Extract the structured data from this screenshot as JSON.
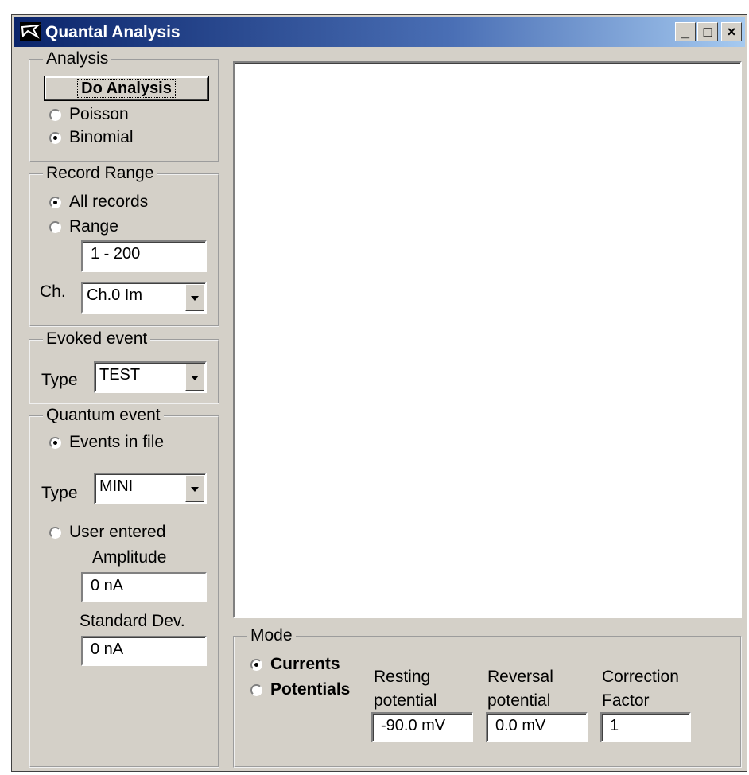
{
  "window": {
    "title": "Quantal Analysis",
    "controls": {
      "minimize": "_",
      "maximize": "□",
      "close": "×"
    }
  },
  "analysis": {
    "legend": "Analysis",
    "do_analysis_label": "Do Analysis",
    "options": [
      {
        "label": "Poisson",
        "selected": false
      },
      {
        "label": "Binomial",
        "selected": true
      }
    ]
  },
  "record_range": {
    "legend": "Record Range",
    "all_records_label": "All records",
    "all_records_selected": true,
    "range_label": "Range",
    "range_selected": false,
    "range_value": "1 - 200",
    "channel_label": "Ch.",
    "channel_value": "Ch.0 Im"
  },
  "evoked_event": {
    "legend": "Evoked event",
    "type_label": "Type",
    "type_value": "TEST"
  },
  "quantum_event": {
    "legend": "Quantum event",
    "events_in_file_label": "Events in file",
    "events_in_file_selected": true,
    "type_label": "Type",
    "type_value": "MINI",
    "user_entered_label": "User entered",
    "user_entered_selected": false,
    "amplitude_label": "Amplitude",
    "amplitude_value": "0 nA",
    "std_dev_label": "Standard Dev.",
    "std_dev_value": "0 nA"
  },
  "mode": {
    "legend": "Mode",
    "currents_label": "Currents",
    "currents_selected": true,
    "potentials_label": "Potentials",
    "potentials_selected": false,
    "resting_label_1": "Resting",
    "resting_label_2": "potential",
    "resting_value": "-90.0 mV",
    "reversal_label_1": "Reversal",
    "reversal_label_2": "potential",
    "reversal_value": "0.0 mV",
    "correction_label_1": "Correction",
    "correction_label_2": "Factor",
    "correction_value": "1"
  }
}
